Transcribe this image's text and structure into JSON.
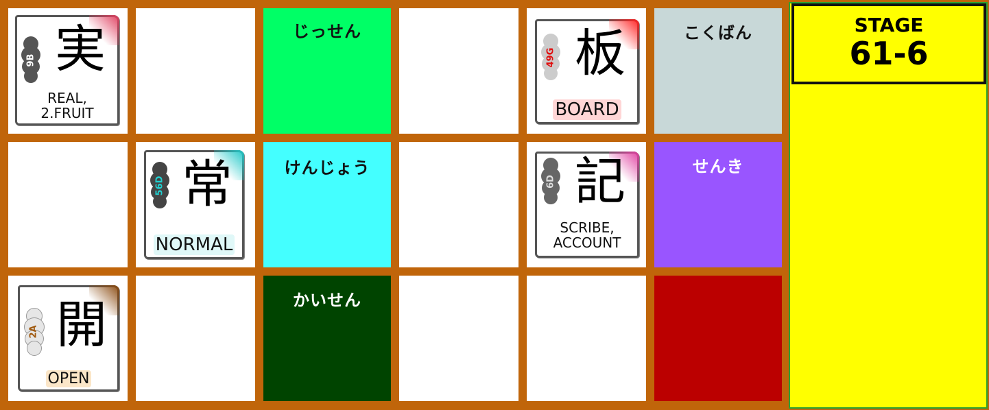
{
  "stage": {
    "label": "STAGE",
    "number": "61-6"
  },
  "cells": {
    "r0c0": {
      "kanji": "実",
      "code": "9B",
      "meaning_line1": "REAL,",
      "meaning_line2": "2.FRUIT",
      "corner_color": "#e04060",
      "cloud_color": "#555555",
      "code_color": "#ffffff",
      "hl_color": "#ffffff"
    },
    "r0c2": {
      "reading": "じっせん",
      "bg": "#00ff66",
      "color": "#111111"
    },
    "r0c4": {
      "kanji": "板",
      "code": "49G",
      "meaning": "BOARD",
      "corner_color": "#ff2020",
      "cloud_color": "#cccccc",
      "code_color": "#e01010",
      "hl_color": "#ffd0d0"
    },
    "r0c5": {
      "reading": "こくばん",
      "bg": "#c8d8d8",
      "color": "#111111"
    },
    "r1c1": {
      "kanji": "常",
      "code": "56D",
      "meaning": "NORMAL",
      "corner_color": "#20c8c8",
      "cloud_color": "#444444",
      "code_color": "#20d0d0",
      "hl_color": "#d8f8f8"
    },
    "r1c2": {
      "reading": "けんじょう",
      "bg": "#44ffff",
      "color": "#111111"
    },
    "r1c4": {
      "kanji": "記",
      "code": "6D",
      "meaning_line1": "SCRIBE,",
      "meaning_line2": "ACCOUNT",
      "corner_color": "#e040a0",
      "cloud_color": "#666666",
      "code_color": "#dddddd",
      "hl_color": "#ffe0f0"
    },
    "r1c5": {
      "reading": "せんき",
      "bg": "#9955ff",
      "color": "#ffffff"
    },
    "r2c0": {
      "kanji": "開",
      "code": "2A",
      "meaning": "OPEN",
      "corner_color": "#8a4a10",
      "cloud_color": "#e8e8e8",
      "code_color": "#a05a10",
      "hl_color": "#f8e0c0"
    },
    "r2c2": {
      "reading": "かいせん",
      "bg": "#004400",
      "color": "#ffffff"
    },
    "r2c5": {
      "reading": "",
      "bg": "#bb0000",
      "color": "#ffffff"
    }
  }
}
